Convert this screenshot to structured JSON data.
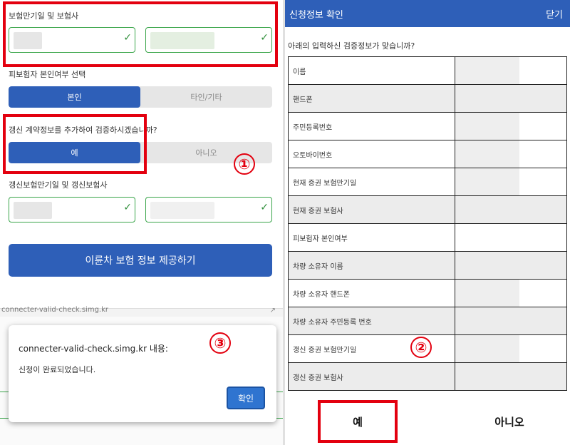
{
  "left": {
    "insurance_label": "보험만기일 및 보험사",
    "insured_self_label": "피보험자 본인여부 선택",
    "insured_options": [
      "본인",
      "타인/기타"
    ],
    "renewal_question": "갱신 계약정보를 추가하여 검증하시겠습니까?",
    "renewal_options": [
      "예",
      "아니오"
    ],
    "renewal_insurance_label": "갱신보험만기일 및 갱신보험사",
    "submit_label": "이륜차 보험 정보 제공하기"
  },
  "alert": {
    "url_text": "connecter-valid-check.simg.kr",
    "host_text": "connecter-valid-check.simg.kr 내용:",
    "message": "신청이 완료되었습니다.",
    "ok_label": "확인"
  },
  "right": {
    "title": "신청정보 확인",
    "close_label": "닫기",
    "question": "아래의 입력하신 검증정보가 맞습니까?",
    "rows": [
      "이름",
      "핸드폰",
      "주민등록번호",
      "오토바이번호",
      "현재 증권 보험만기일",
      "현재 증권 보험사",
      "피보험자 본인여부",
      "차량 소유자 이름",
      "차량 소유자 핸드폰",
      "차량 소유자 주민등록 번호",
      "갱신 증권 보험만기일",
      "갱신 증권 보험사"
    ],
    "yes_label": "예",
    "no_label": "아니오"
  },
  "markers": [
    "①",
    "②",
    "③"
  ],
  "colors": {
    "accent": "#2e5fb8",
    "highlight": "#e3000f",
    "valid": "#3aa54a"
  }
}
